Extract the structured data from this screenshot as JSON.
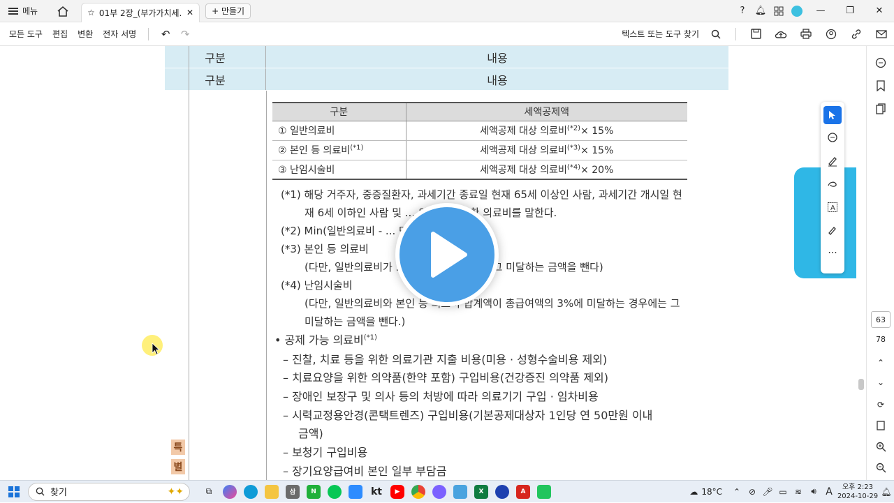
{
  "titlebar": {
    "menu_label": "메뉴",
    "tab_title": "01부 2장_(부가가치세...",
    "new_button_label": "+ 만들기"
  },
  "toolbar": {
    "items": [
      "모든 도구",
      "편집",
      "변환",
      "전자 서명"
    ],
    "find_label": "텍스트 또는 도구 찾기"
  },
  "document": {
    "header_rows": [
      {
        "col1": "구분",
        "col2": "내용"
      },
      {
        "col1": "구분",
        "col2": "내용"
      }
    ],
    "table": {
      "headers": [
        "구분",
        "세액공제액"
      ],
      "rows": [
        {
          "label": "① 일반의료비",
          "label_sup": "",
          "formula": "세액공제 대상 의료비",
          "sup": "(*2)",
          "rate": "× 15%"
        },
        {
          "label": "② 본인 등 의료비",
          "label_sup": "(*1)",
          "formula": "세액공제 대상 의료비",
          "sup": "(*3)",
          "rate": "× 15%"
        },
        {
          "label": "③ 난임시술비",
          "label_sup": "",
          "formula": "세액공제 대상 의료비",
          "sup": "(*4)",
          "rate": "× 20%"
        }
      ]
    },
    "notes": [
      "(*1) 해당 거주자, 중증질환자, 과세기간 종료일 현재 65세 이상인 사람, 과세기간 개시일 현",
      "재 6세 이하인 사람 및 ... 위하여 지급한 의료비를 말한다.",
      "(*2) Min(일반의료비 - ... 만원)",
      "(*3) 본인 등 의료비",
      "(다만, 일반의료비가 ... 미달하는 경우에는 그 미달하는 금액을 뺀다)",
      "(*4) 난임시술비",
      "(다만, 일반의료비와 본인 등 의료비 합계액이 총급여액의 3%에 미달하는 경우에는 그",
      "미달하는 금액을 뺀다.)"
    ],
    "bullet_title": "• 공제 가능 의료비",
    "bullet_title_sup": "(*1)",
    "bullet_items": [
      "– 진찰, 치료 등을 위한 의료기관 지출 비용(미용 · 성형수술비용 제외)",
      "– 치료요양을 위한 의약품(한약 포함) 구입비용(건강증진 의약품 제외)",
      "– 장애인 보장구 및 의사 등의 처방에 따라 의료기기 구입 · 임차비용",
      "– 시력교정용안경(콘택트렌즈) 구입비용(기본공제대상자 1인당 연 50만원 이내",
      "금액)",
      "– 보청기 구입비용",
      "– 장기요양급여비 본인 일부 부담금"
    ],
    "side_tags": [
      "특",
      "별"
    ]
  },
  "read_aloud_label": "이른 읽히기",
  "page_numbers": {
    "current": "63",
    "total": "78"
  },
  "taskbar": {
    "search_placeholder": "찾기",
    "weather": "18°C",
    "time": "오후 2:23",
    "date": "2024-10-29",
    "ime": "A"
  },
  "colors": {
    "header_bg": "#d7ecf4",
    "accent": "#2fb7e6",
    "play": "#4a9fe6"
  }
}
